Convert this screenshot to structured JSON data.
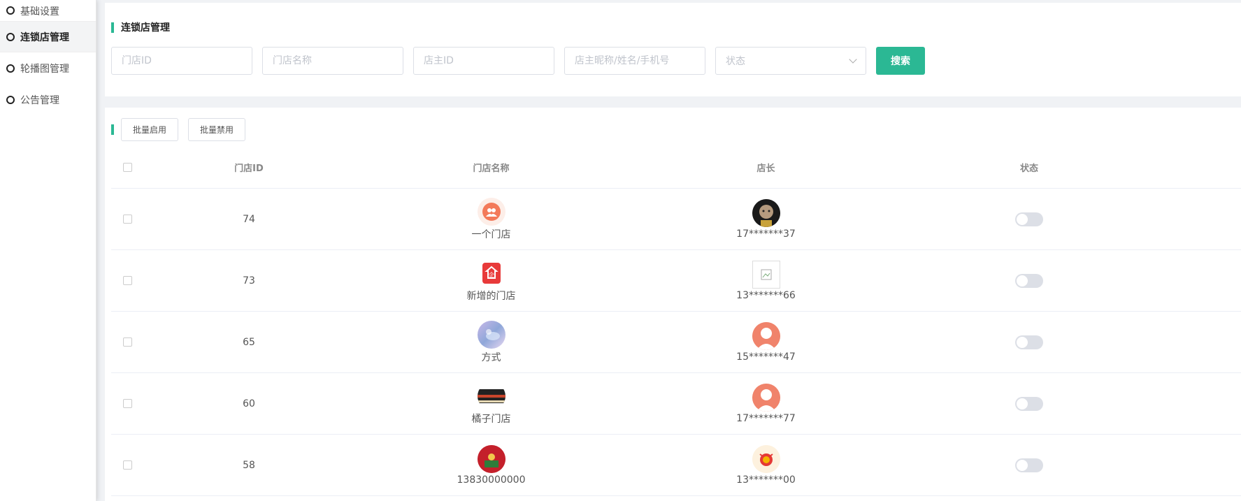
{
  "sidebar": {
    "items": [
      {
        "label": "基础设置"
      },
      {
        "label": "连锁店管理",
        "active": true
      },
      {
        "label": "轮播图管理"
      },
      {
        "label": "公告管理"
      }
    ]
  },
  "filters": {
    "title": "连锁店管理",
    "store_id_placeholder": "门店ID",
    "store_name_placeholder": "门店名称",
    "owner_id_placeholder": "店主ID",
    "owner_info_placeholder": "店主昵称/姓名/手机号",
    "status_placeholder": "状态",
    "search_label": "搜索"
  },
  "batch": {
    "enable_label": "批量启用",
    "disable_label": "批量禁用"
  },
  "table": {
    "headers": {
      "id": "门店ID",
      "name": "门店名称",
      "owner": "店长",
      "status": "状态"
    },
    "rows": [
      {
        "id": "74",
        "name": "一个门店",
        "owner": "17*******37",
        "enabled": false
      },
      {
        "id": "73",
        "name": "新增的门店",
        "owner": "13*******66",
        "enabled": false
      },
      {
        "id": "65",
        "name": "方式",
        "owner": "15*******47",
        "enabled": false
      },
      {
        "id": "60",
        "name": "橘子门店",
        "owner": "17*******77",
        "enabled": false
      },
      {
        "id": "58",
        "name": "13830000000",
        "owner": "13*******00",
        "enabled": false
      }
    ]
  },
  "colors": {
    "accent": "#2bb894"
  }
}
